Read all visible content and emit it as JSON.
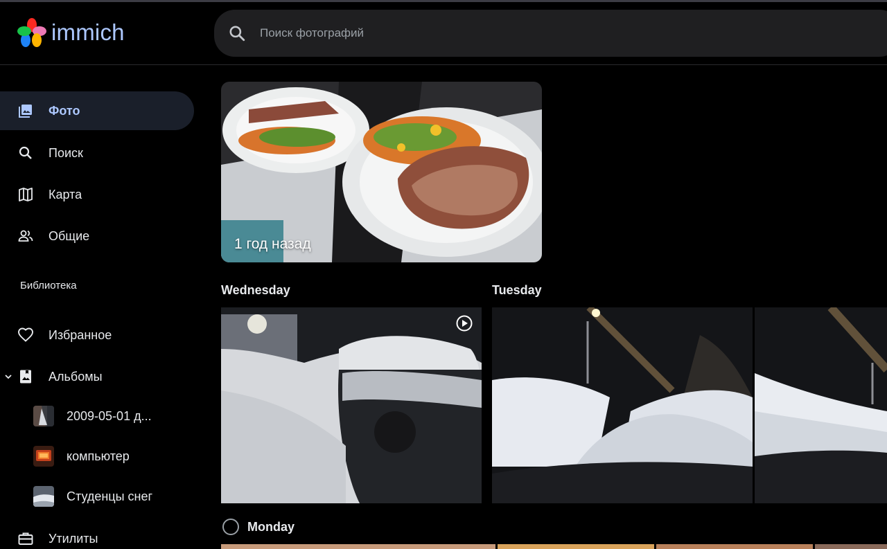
{
  "app": {
    "name": "immich"
  },
  "search": {
    "placeholder": "Поиск фотографий"
  },
  "nav": {
    "photos": "Фото",
    "search": "Поиск",
    "map": "Карта",
    "sharing": "Общие"
  },
  "library": {
    "section_label": "Библиотека",
    "favorites": "Избранное",
    "albums": "Альбомы",
    "album_items": [
      "2009-05-01 д...",
      "компьютер",
      "Студенцы снег"
    ],
    "utilities": "Утилиты"
  },
  "memory": {
    "caption": "1 год назад"
  },
  "timeline": {
    "groups": [
      "Wednesday",
      "Tuesday",
      "Monday"
    ]
  },
  "colors": {
    "accent": "#adc8ff",
    "active_bg": "#1a1f2a",
    "search_bg": "#1f1f21"
  }
}
